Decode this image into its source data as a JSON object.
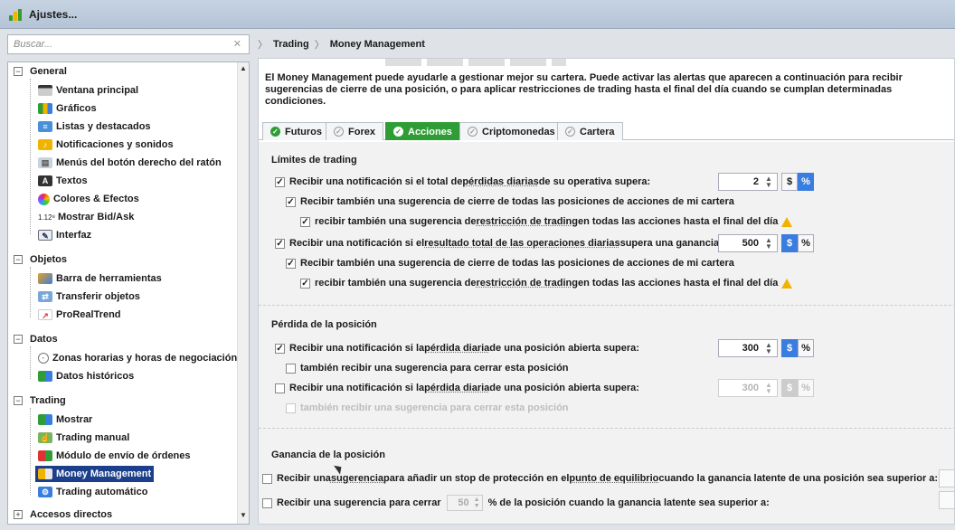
{
  "window": {
    "title": "Ajustes..."
  },
  "search": {
    "placeholder": "Buscar..."
  },
  "tree": {
    "groups": [
      {
        "label": "General",
        "items": [
          "Ventana principal",
          "Gráficos",
          "Listas y destacados",
          "Notificaciones y sonidos",
          "Menús del botón derecho del ratón",
          "Textos",
          "Colores & Efectos",
          "Mostrar Bid/Ask",
          "Interfaz"
        ]
      },
      {
        "label": "Objetos",
        "items": [
          "Barra de herramientas",
          "Transferir objetos",
          "ProRealTrend"
        ]
      },
      {
        "label": "Datos",
        "items": [
          "Zonas horarias y horas de negociación",
          "Datos históricos"
        ]
      },
      {
        "label": "Trading",
        "items": [
          "Mostrar",
          "Trading manual",
          "Módulo de envío de órdenes",
          "Money Management",
          "Trading automático"
        ]
      },
      {
        "label": "Accesos directos",
        "items": []
      }
    ],
    "bidask_prefix": "1.12⁸",
    "selected": "Money Management"
  },
  "breadcrumb": {
    "items": [
      "Trading",
      "Money Management"
    ]
  },
  "intro": "El Money Management puede ayudarle a gestionar mejor su cartera. Puede activar las alertas que aparecen a continuación para recibir sugerencias de cierre de una posición, o para aplicar restricciones de trading hasta el final del día cuando se cumplan determinadas condiciones.",
  "tabs": [
    {
      "label": "Futuros",
      "state": "ok"
    },
    {
      "label": "Forex",
      "state": "off"
    },
    {
      "label": "Acciones",
      "state": "active"
    },
    {
      "label": "Criptomonedas",
      "state": "off"
    },
    {
      "label": "Cartera",
      "state": "off"
    }
  ],
  "limits": {
    "title": "Límites de trading",
    "loss_row": {
      "a": "Recibir una notificación si el total de ",
      "u": "pérdidas diarias",
      "b": " de su operativa supera:",
      "value": "2",
      "checked": true,
      "unit_dollar": "$",
      "unit_pct": "%",
      "selected_unit": "%"
    },
    "loss_close": "Recibir también una sugerencia de cierre de todas las posiciones de acciones de mi cartera",
    "loss_restrict": {
      "a": "recibir también una sugerencia de ",
      "u": "restricción de trading",
      "b": " en todas las acciones hasta el final del día"
    },
    "gain_row": {
      "a": "Recibir una notificación si el ",
      "u": "resultado total de las operaciones diarias",
      "b": " supera una ganancia de:",
      "value": "500",
      "checked": true,
      "unit_dollar": "$",
      "unit_pct": "%",
      "selected_unit": "$"
    },
    "gain_close": "Recibir también una sugerencia de cierre de todas las posiciones de acciones de mi cartera",
    "gain_restrict": {
      "a": "recibir también una sugerencia de ",
      "u": "restricción de trading",
      "b": " en todas las acciones hasta el final del día"
    }
  },
  "position_loss": {
    "title": "Pérdida de la posición",
    "row1": {
      "a": "Recibir una notificación si la ",
      "u": "pérdida diaria",
      "b": " de una posición abierta supera:",
      "value": "300",
      "checked": true,
      "unit_dollar": "$",
      "unit_pct": "%",
      "selected_unit": "$"
    },
    "row1_sub": "también recibir una sugerencia para cerrar esta posición",
    "row2": {
      "a": "Recibir una notificación si la ",
      "u": "pérdida diaria",
      "b": " de una posición abierta supera:",
      "value": "300",
      "checked": false,
      "unit_dollar": "$",
      "unit_pct": "%",
      "selected_unit": "$"
    },
    "row2_sub": "también recibir una sugerencia para cerrar esta posición"
  },
  "position_gain": {
    "title": "Ganancia de la posición",
    "row1": {
      "a": "Recibir una ",
      "u1": "sugerencia",
      "m": " para añadir un stop de protección en el ",
      "u2": "punto de equilibrio",
      "b": " cuando la ganancia latente de una posición sea superior a:"
    },
    "row2": {
      "a": "Recibir una sugerencia para cerrar",
      "value": "50",
      "b": "% de la posición cuando la ganancia latente sea superior a:"
    }
  },
  "colors": {
    "accent_green": "#2f9d35",
    "selected_blue": "#1c3f8c",
    "toggle_blue": "#3a7de0",
    "warning": "#f0b400"
  }
}
